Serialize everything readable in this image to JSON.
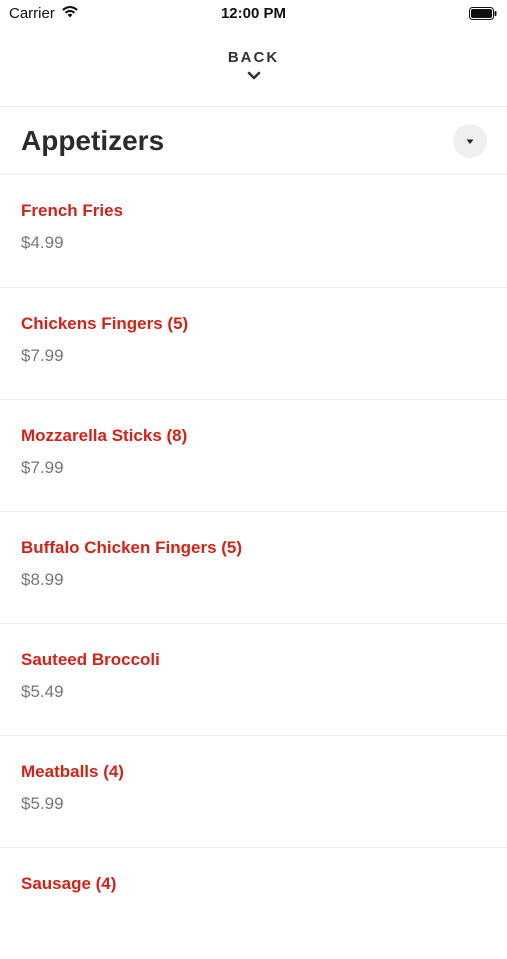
{
  "status_bar": {
    "carrier": "Carrier",
    "time": "12:00 PM",
    "wifi_icon": "wifi-icon",
    "battery_icon": "battery-icon"
  },
  "nav": {
    "back_label": "BACK",
    "back_icon": "chevron-down-icon"
  },
  "section": {
    "title": "Appetizers",
    "dropdown_icon": "caret-down-icon"
  },
  "menu_items": [
    {
      "name": "French Fries",
      "price": "$4.99"
    },
    {
      "name": "Chickens Fingers (5)",
      "price": "$7.99"
    },
    {
      "name": "Mozzarella Sticks (8)",
      "price": "$7.99"
    },
    {
      "name": "Buffalo Chicken Fingers (5)",
      "price": "$8.99"
    },
    {
      "name": "Sauteed Broccoli",
      "price": "$5.49"
    },
    {
      "name": "Meatballs (4)",
      "price": "$5.99"
    },
    {
      "name": "Sausage (4)",
      "price": ""
    }
  ],
  "colors": {
    "item_name": "#d42316",
    "price": "#777777",
    "divider": "#ececec"
  }
}
